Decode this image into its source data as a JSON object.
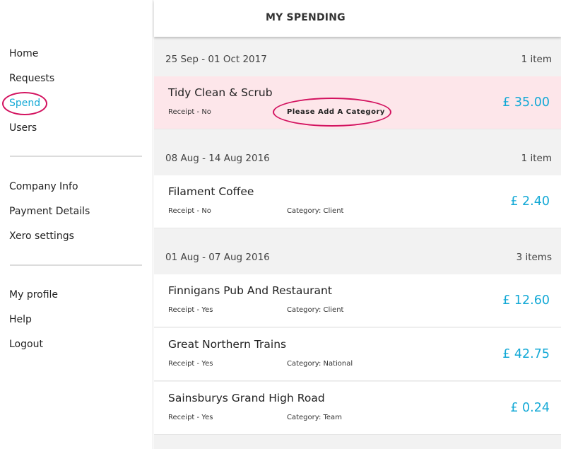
{
  "header": {
    "title": "MY SPENDING"
  },
  "sidebar": {
    "primary": [
      {
        "label": "Home",
        "active": false
      },
      {
        "label": "Requests",
        "active": false
      },
      {
        "label": "Spend",
        "active": true
      },
      {
        "label": "Users",
        "active": false
      }
    ],
    "company": [
      {
        "label": "Company Info"
      },
      {
        "label": "Payment Details"
      },
      {
        "label": "Xero settings"
      }
    ],
    "account": [
      {
        "label": "My profile"
      },
      {
        "label": "Help"
      },
      {
        "label": "Logout"
      }
    ]
  },
  "weeks": [
    {
      "range": "25 Sep - 01 Oct 2017",
      "count": "1 item",
      "items": [
        {
          "merchant": "Tidy Clean & Scrub",
          "receipt": "Receipt - No",
          "category": "Please Add A Category",
          "amount": "£ 35.00",
          "needs_category": true
        }
      ]
    },
    {
      "range": "08 Aug - 14 Aug 2016",
      "count": "1 item",
      "items": [
        {
          "merchant": "Filament Coffee",
          "receipt": "Receipt - No",
          "category": "Category: Client",
          "amount": "£ 2.40",
          "needs_category": false
        }
      ]
    },
    {
      "range": "01 Aug - 07 Aug 2016",
      "count": "3 items",
      "items": [
        {
          "merchant": "Finnigans Pub And Restaurant",
          "receipt": "Receipt - Yes",
          "category": "Category: Client",
          "amount": "£ 12.60",
          "needs_category": false
        },
        {
          "merchant": "Great Northern Trains",
          "receipt": "Receipt - Yes",
          "category": "Category: National",
          "amount": "£ 42.75",
          "needs_category": false
        },
        {
          "merchant": "Sainsburys Grand High Road",
          "receipt": "Receipt - Yes",
          "category": "Category: Team",
          "amount": "£ 0.24",
          "needs_category": false
        }
      ]
    }
  ],
  "colors": {
    "accent": "#14a9d6",
    "highlight_ring": "#d3125f",
    "alert_row": "#fde6ea"
  }
}
